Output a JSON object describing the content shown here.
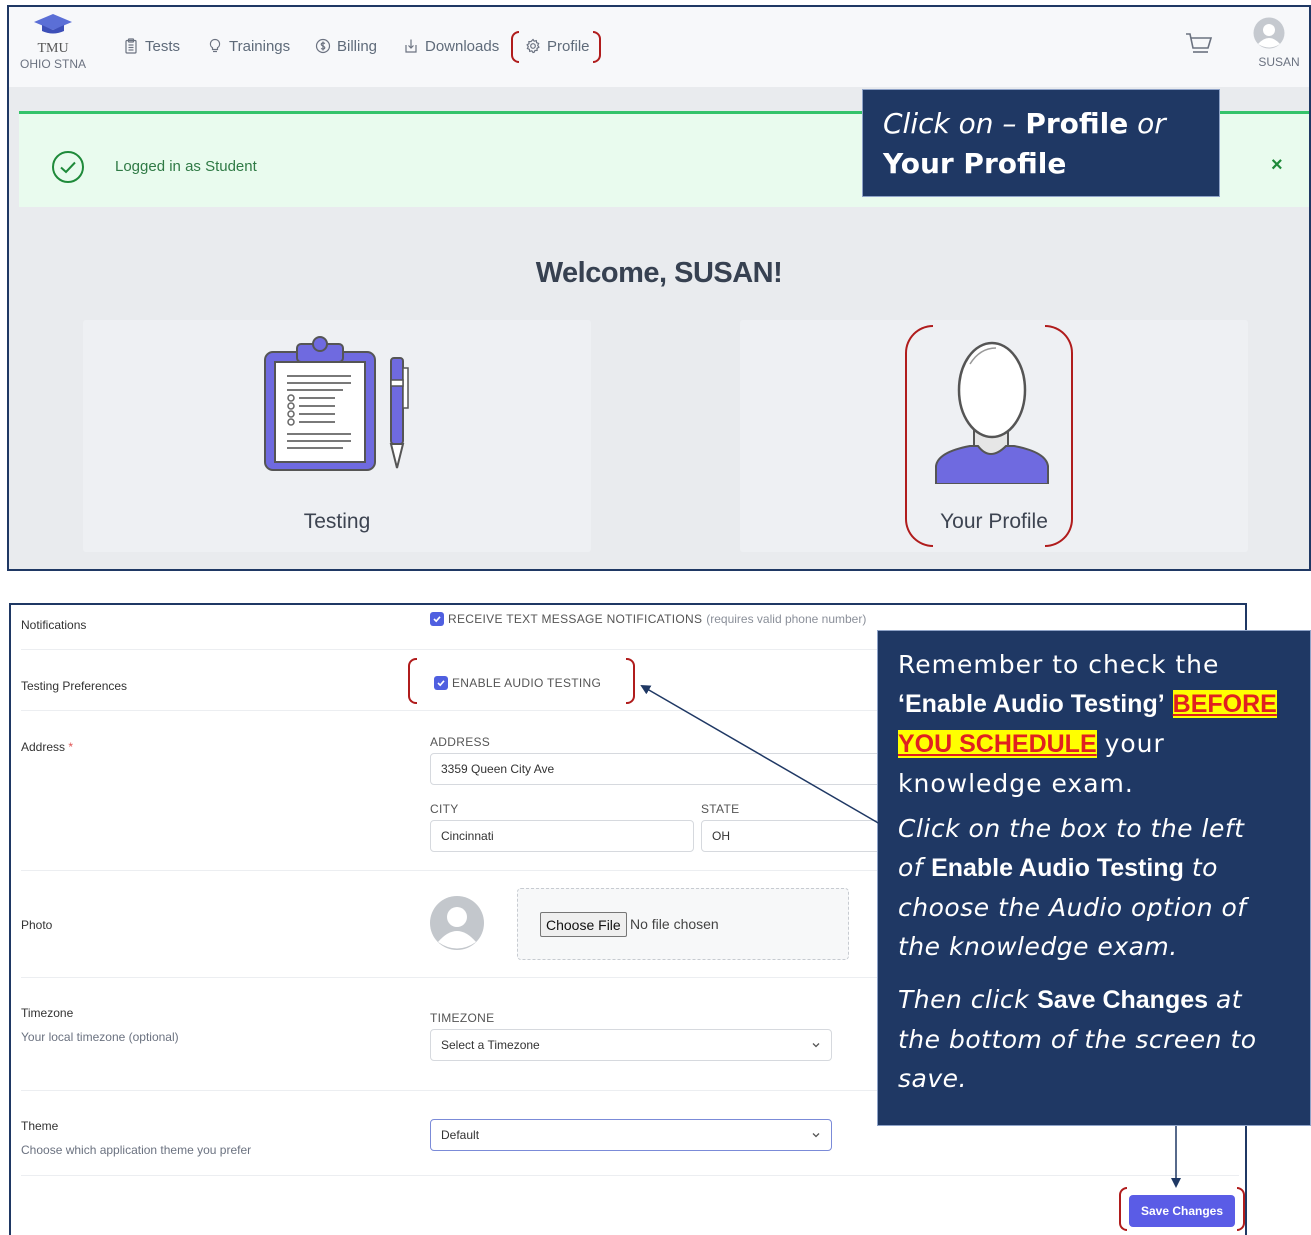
{
  "navbar": {
    "logo_line1": "TMU",
    "logo_line2": "OHIO STNA",
    "items": [
      {
        "label": "Tests",
        "icon": "clipboard-icon"
      },
      {
        "label": "Trainings",
        "icon": "lightbulb-icon"
      },
      {
        "label": "Billing",
        "icon": "dollar-icon"
      },
      {
        "label": "Downloads",
        "icon": "download-icon"
      },
      {
        "label": "Profile",
        "icon": "gear-icon"
      }
    ],
    "cart_icon": "cart-icon",
    "user_name": "SUSAN"
  },
  "alert": {
    "text": "Logged in as Student",
    "close": "×"
  },
  "dashboard": {
    "welcome": "Welcome, SUSAN!",
    "cards": [
      {
        "label": "Testing",
        "icon": "clipboard-pen-illustration"
      },
      {
        "label": "Your Profile",
        "icon": "person-illustration"
      }
    ]
  },
  "callout_top": {
    "click_on": "Click on –",
    "profile": "Profile",
    "or": "or",
    "your_profile": "Your Profile"
  },
  "form": {
    "notifications": {
      "label": "Notifications",
      "checkbox_label": "RECEIVE TEXT MESSAGE NOTIFICATIONS",
      "hint": "(requires valid phone number)",
      "checked": true
    },
    "testing_preferences": {
      "label": "Testing Preferences",
      "checkbox_label": "ENABLE AUDIO TESTING",
      "checked": true
    },
    "address": {
      "label": "Address",
      "required_mark": "*",
      "address_caption": "ADDRESS",
      "address_value": "3359 Queen City Ave",
      "city_caption": "CITY",
      "city_value": "Cincinnati",
      "state_caption": "STATE",
      "state_value": "OH"
    },
    "photo": {
      "label": "Photo",
      "choose_file": "Choose File",
      "no_file": "No file chosen"
    },
    "timezone": {
      "label": "Timezone",
      "sublabel": "Your local timezone (optional)",
      "caption": "TIMEZONE",
      "value": "Select a Timezone"
    },
    "theme": {
      "label": "Theme",
      "sublabel": "Choose which application theme you prefer",
      "value": "Default"
    },
    "save_label": "Save Changes"
  },
  "callout_bottom": {
    "p1_a": "Remember to check the",
    "p1_b": "‘Enable Audio Testing’",
    "p1_hl1": "BEFORE",
    "p1_hl2": "YOU SCHEDULE",
    "p1_c": "your",
    "p1_d": "knowledge exam.",
    "p2_a": "Click on the box to the left",
    "p2_b": "of",
    "p2_c": "Enable Audio Testing",
    "p2_d": "to",
    "p2_e": "choose the Audio option of",
    "p2_f": "the knowledge exam.",
    "p3_a": "Then click",
    "p3_b": "Save Changes",
    "p3_c": "at",
    "p3_d": "the bottom of the screen to",
    "p3_e": "save."
  },
  "colors": {
    "frame": "#1f3864",
    "callout_bg": "#1f3864",
    "bracket": "#b01c1c",
    "accent": "#5a5ce6",
    "alert_bg": "#e9fbee",
    "alert_green": "#34c36a",
    "highlight": "#ffff00",
    "highlight_text": "#e02020"
  }
}
